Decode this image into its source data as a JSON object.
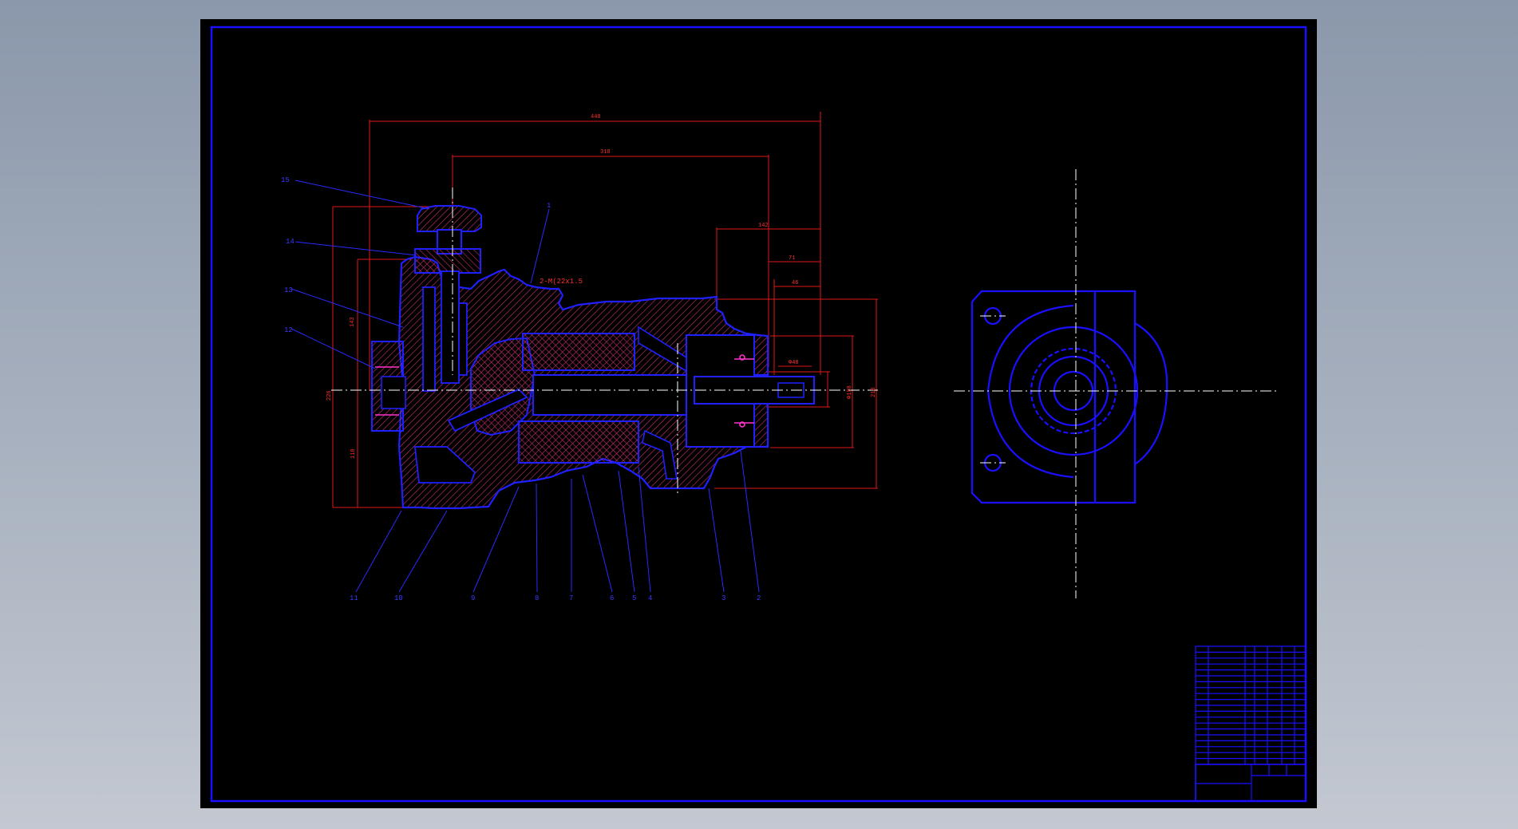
{
  "drawing": {
    "background": "#000000",
    "frame_color": "#1a10ff",
    "section_color": "#2020ff",
    "hatch_color": "#c0306a",
    "dimension_color": "#e01818",
    "centerline_color": "#ffffff"
  },
  "dimensions": {
    "overall_length": "448",
    "length_318": "318",
    "length_142": "142",
    "length_71": "71",
    "length_46": "46",
    "height_143": "143",
    "height_226": "226",
    "height_118": "118",
    "shaft_dia": "Φ40",
    "flange_dia": "Φ108",
    "outer_dia": "218",
    "thread_note": "2-M(22x1.5"
  },
  "part_numbers": [
    "15",
    "14",
    "13",
    "12",
    "1",
    "11",
    "10",
    "9",
    "8",
    "7",
    "6",
    "5",
    "4",
    "3",
    "2"
  ],
  "title_block": {
    "rows": 20
  }
}
